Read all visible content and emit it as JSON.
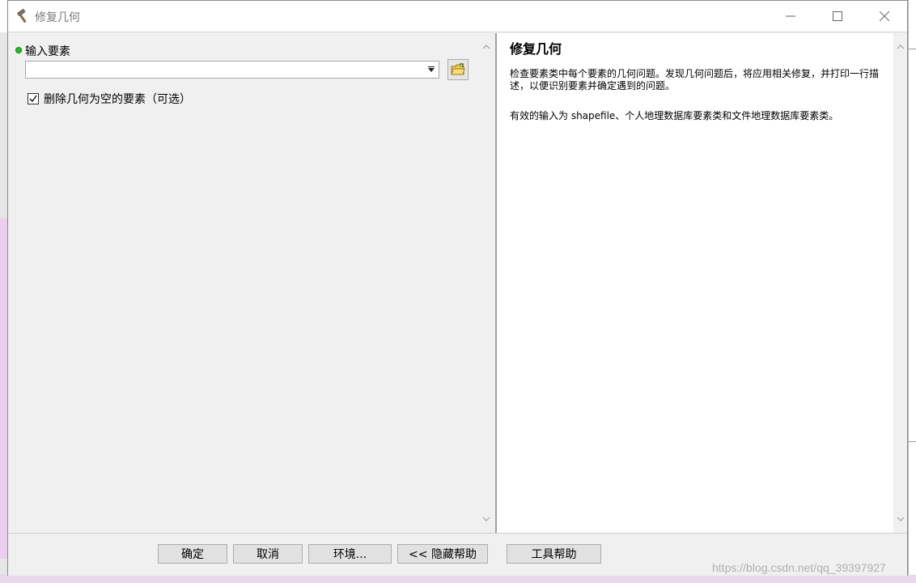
{
  "window": {
    "title": "修复几何",
    "controls": {
      "minimize": "minimize",
      "maximize": "maximize",
      "close": "close"
    }
  },
  "left_pane": {
    "input_label": "输入要素",
    "input_value": "",
    "checkbox_label": "删除几何为空的要素（可选）",
    "checkbox_checked": true
  },
  "help": {
    "title": "修复几何",
    "paragraph1": "检查要素类中每个要素的几何问题。发现几何问题后，将应用相关修复，并打印一行描述，以便识别要素并确定遇到的问题。",
    "paragraph2": "有效的输入为 shapefile、个人地理数据库要素类和文件地理数据库要素类。"
  },
  "footer": {
    "ok": "确定",
    "cancel": "取消",
    "environments": "环境...",
    "hide_help": "<< 隐藏帮助",
    "tool_help": "工具帮助"
  },
  "watermark": "https://blog.csdn.net/qq_39397927"
}
